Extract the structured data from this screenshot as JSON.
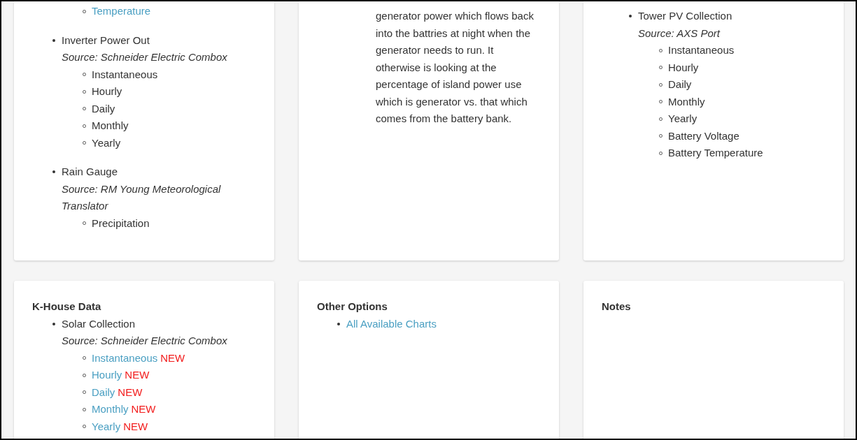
{
  "top_cards": [
    {
      "items": [
        {
          "children": [
            {
              "label": "Temperature",
              "kind": "link"
            }
          ]
        },
        {
          "label": "Inverter Power Out",
          "kind": "text",
          "source": "Source: Schneider Electric Combox",
          "children": [
            {
              "label": "Instantaneous",
              "kind": "text"
            },
            {
              "label": "Hourly",
              "kind": "text"
            },
            {
              "label": "Daily",
              "kind": "text"
            },
            {
              "label": "Monthly",
              "kind": "text"
            },
            {
              "label": "Yearly",
              "kind": "text"
            }
          ]
        },
        {
          "label": "Rain Gauge",
          "kind": "text",
          "source": "Source: RM Young Meteorological Translator",
          "children": [
            {
              "label": "Precipitation",
              "kind": "text"
            }
          ]
        }
      ]
    },
    {
      "paragraph": "generator power which flows back into the battries at night when the generator needs to run. It otherwise is looking at the percentage of island power use which is generator vs. that which comes from the battery bank."
    },
    {
      "items": [
        {
          "label": "Tower PV Collection",
          "kind": "text",
          "source": "Source: AXS Port",
          "children": [
            {
              "label": "Instantaneous",
              "kind": "text"
            },
            {
              "label": "Hourly",
              "kind": "text"
            },
            {
              "label": "Daily",
              "kind": "text"
            },
            {
              "label": "Monthly",
              "kind": "text"
            },
            {
              "label": "Yearly",
              "kind": "text"
            },
            {
              "label": "Battery Voltage",
              "kind": "text"
            },
            {
              "label": "Battery Temperature",
              "kind": "text"
            }
          ]
        }
      ]
    }
  ],
  "bottom_cards": [
    {
      "heading": "K-House Data",
      "items": [
        {
          "label": "Solar Collection",
          "kind": "text",
          "source": "Source: Schneider Electric Combox",
          "children": [
            {
              "label": "Instantaneous",
              "kind": "link",
              "badge": "NEW"
            },
            {
              "label": "Hourly",
              "kind": "link",
              "badge": "NEW"
            },
            {
              "label": "Daily",
              "kind": "link",
              "badge": "NEW"
            },
            {
              "label": "Monthly",
              "kind": "link",
              "badge": "NEW"
            },
            {
              "label": "Yearly",
              "kind": "link",
              "badge": "NEW"
            }
          ]
        }
      ]
    },
    {
      "heading": "Other Options",
      "items": [
        {
          "label": "All Available Charts",
          "kind": "link"
        }
      ]
    },
    {
      "heading": "Notes"
    }
  ]
}
